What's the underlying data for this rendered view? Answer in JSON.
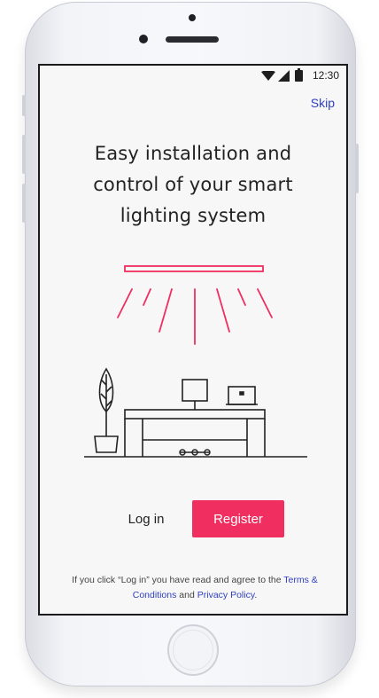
{
  "status_bar": {
    "time": "12:30",
    "icons": [
      "wifi-icon",
      "signal-icon",
      "battery-icon"
    ]
  },
  "header": {
    "skip_label": "Skip"
  },
  "onboarding": {
    "title_lines": [
      "Easy installation and",
      "control of your smart",
      "lighting system"
    ]
  },
  "actions": {
    "login_label": "Log in",
    "register_label": "Register"
  },
  "legal": {
    "prefix": "If you click “Log in” you have read and agree to the ",
    "terms_link": "Terms & Conditions",
    "middle": " and ",
    "privacy_link": "Privacy Policy",
    "suffix": "."
  },
  "colors": {
    "accent": "#f02e5f",
    "link": "#2e3fbf",
    "line_art": "#222222"
  }
}
